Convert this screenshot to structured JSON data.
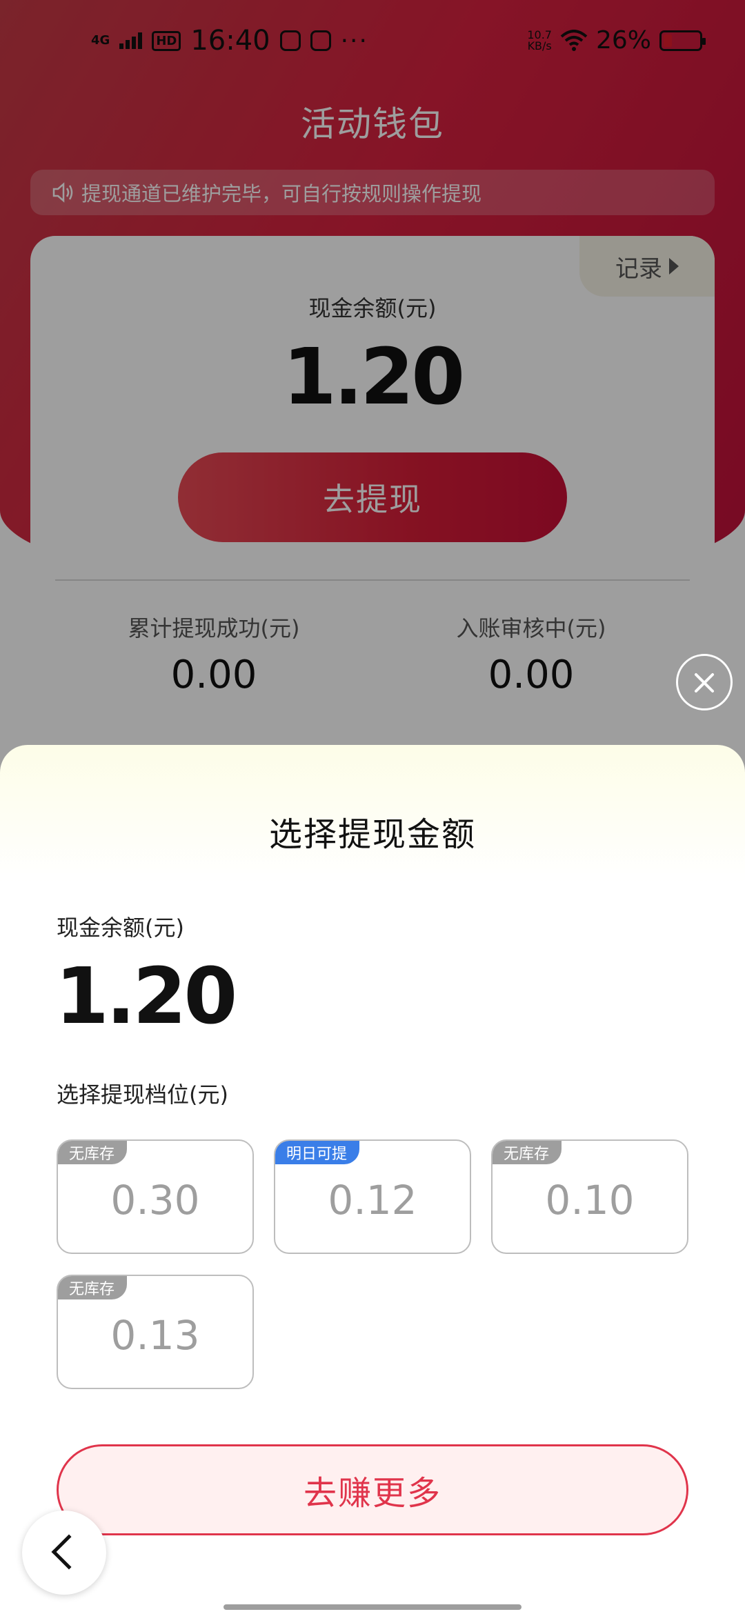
{
  "status_bar": {
    "network": "4G",
    "hd": "HD",
    "time": "16:40",
    "more": "···",
    "speed_value": "10.7",
    "speed_unit": "KB/s",
    "battery_pct": "26%"
  },
  "page": {
    "title": "活动钱包",
    "notice": "提现通道已维护完毕，可自行按规则操作提现"
  },
  "wallet": {
    "record_label": "记录",
    "balance_label": "现金余额(元)",
    "balance_value": "1.20",
    "withdraw_label": "去提现",
    "stats": [
      {
        "label": "累计提现成功(元)",
        "value": "0.00"
      },
      {
        "label": "入账审核中(元)",
        "value": "0.00"
      }
    ]
  },
  "sheet": {
    "title": "选择提现金额",
    "balance_label": "现金余额(元)",
    "balance_value": "1.20",
    "tier_label": "选择提现档位(元)",
    "tiers": [
      {
        "value": "0.30",
        "badge": "无库存",
        "badge_color": "#9e9e9e"
      },
      {
        "value": "0.12",
        "badge": "明日可提",
        "badge_color": "#3a7ee8"
      },
      {
        "value": "0.10",
        "badge": "无库存",
        "badge_color": "#9e9e9e"
      },
      {
        "value": "0.13",
        "badge": "无库存",
        "badge_color": "#9e9e9e"
      }
    ],
    "earn_label": "去赚更多"
  },
  "colors": {
    "brand_red": "#d71d38",
    "accent_blue": "#3a7ee8",
    "muted_gray": "#9e9e9e"
  }
}
